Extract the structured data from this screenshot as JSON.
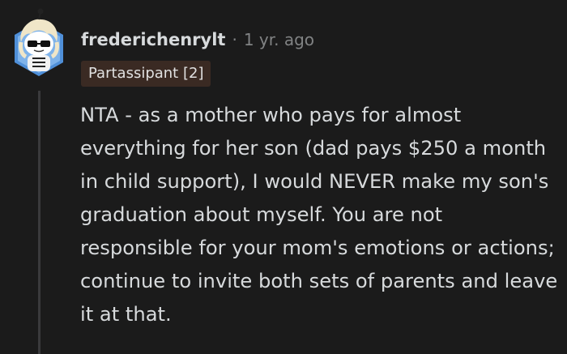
{
  "comment": {
    "author": "frederichenrylt",
    "separator": "·",
    "timestamp": "1 yr. ago",
    "flair": "Partassipant [2]",
    "avatar_icon": "snoo-avatar-icon",
    "body": "NTA - as a mother who pays for almost everything for her son (dad pays $250 a month in child support), I would NEVER make my son's graduation about myself. You are not responsible for your mom's emotions or actions; continue to invite both sets of parents and leave it at that."
  },
  "colors": {
    "background": "#1b1b1b",
    "text": "#d7dadc",
    "meta": "#818384",
    "flair_bg": "#3a2a23",
    "thread_line": "#3a3a3c",
    "avatar_badge": "#4f8fd8"
  }
}
